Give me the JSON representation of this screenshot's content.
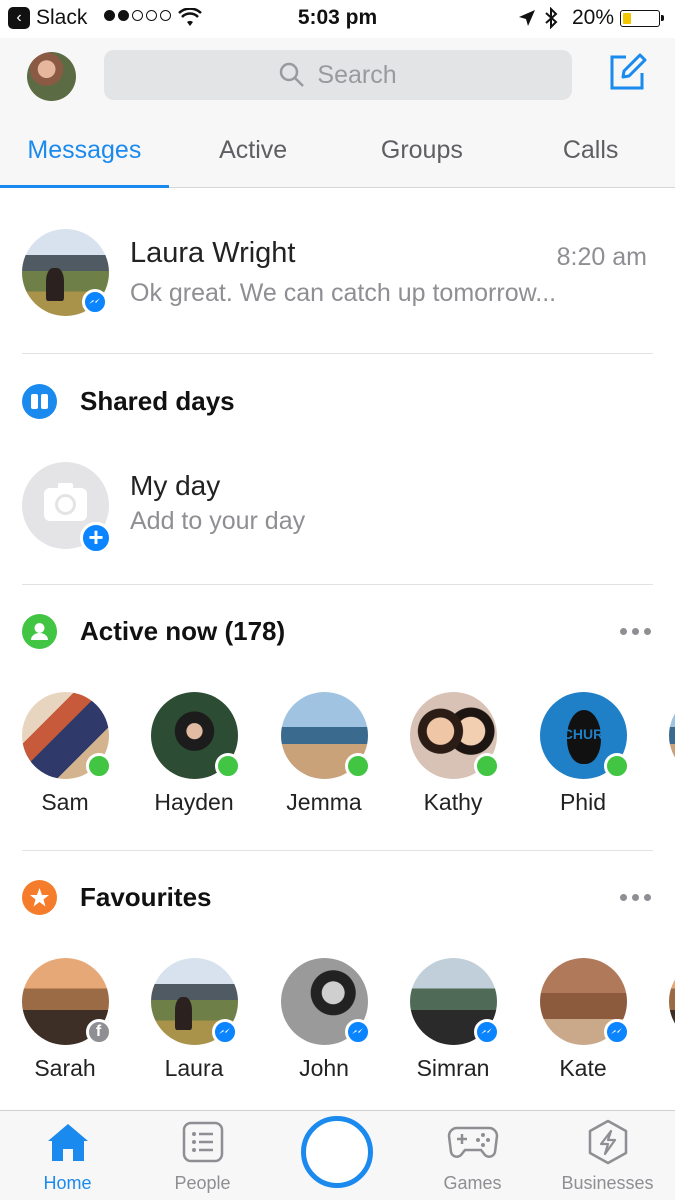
{
  "status_bar": {
    "back_app": "Slack",
    "time": "5:03 pm",
    "battery": "20%",
    "signal_bars_filled": 2,
    "signal_bars_total": 5
  },
  "header": {
    "search_placeholder": "Search",
    "tabs": [
      {
        "label": "Messages",
        "active": true
      },
      {
        "label": "Active",
        "active": false
      },
      {
        "label": "Groups",
        "active": false
      },
      {
        "label": "Calls",
        "active": false
      }
    ]
  },
  "conversation": {
    "name": "Laura Wright",
    "time": "8:20 am",
    "preview": "Ok great. We can catch up tomorrow..."
  },
  "shared_days": {
    "title": "Shared days",
    "my_day_title": "My day",
    "my_day_subtitle": "Add to your day"
  },
  "active_now": {
    "title": "Active now (178)",
    "people": [
      "Sam",
      "Hayden",
      "Jemma",
      "Kathy",
      "Phid"
    ],
    "avatar_text": "CHUR"
  },
  "favourites": {
    "title": "Favourites",
    "people": [
      "Sarah",
      "Laura",
      "John",
      "Simran",
      "Kate"
    ]
  },
  "tabbar": {
    "items": [
      {
        "label": "Home",
        "icon": "home-icon",
        "active": true
      },
      {
        "label": "People",
        "icon": "people-list-icon",
        "active": false
      },
      {
        "label": "",
        "icon": "camera-circle-icon",
        "active": false
      },
      {
        "label": "Games",
        "icon": "gamepad-icon",
        "active": false
      },
      {
        "label": "Businesses",
        "icon": "lightning-icon",
        "active": false
      }
    ]
  },
  "colors": {
    "accent": "#1b8aee",
    "online": "#42c542",
    "favourites": "#f47c2b",
    "messenger": "#0a84ff"
  }
}
